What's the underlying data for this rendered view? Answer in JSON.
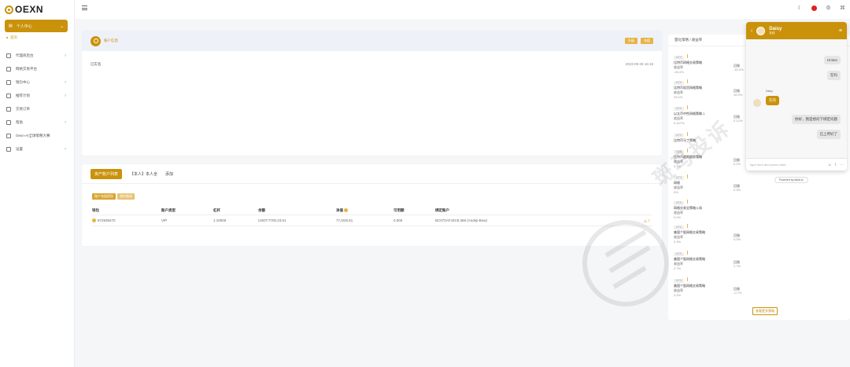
{
  "app": {
    "logo_text": "OEXN"
  },
  "colors": {
    "accent": "#c9920a",
    "accent_light": "#e5b447",
    "alert": "#e02020"
  },
  "sidebar": {
    "active_item": "个人中心",
    "active_subitem": "首页",
    "items": [
      {
        "label": "代理商后台",
        "icon": "grid-icon",
        "has_children": true
      },
      {
        "label": "网格交易平台",
        "icon": "trade-icon",
        "has_children": false
      },
      {
        "label": "钱包中心",
        "icon": "wallet-icon",
        "has_children": true
      },
      {
        "label": "推荐计划",
        "icon": "link-icon",
        "has_children": true
      },
      {
        "label": "交易订单",
        "icon": "order-icon",
        "has_children": false
      },
      {
        "label": "帮助",
        "icon": "help-icon",
        "has_children": true
      },
      {
        "label": "Oexn-AI全球策略大赛",
        "icon": "ai-icon",
        "has_children": false
      },
      {
        "label": "设置",
        "icon": "settings-icon",
        "has_children": true
      }
    ]
  },
  "profile_card": {
    "name": "账户信息",
    "btn1": "升级",
    "btn2": "充值",
    "row_label": "已实名",
    "row_time": "2023-09-28 16:18"
  },
  "accounts_card": {
    "tabs": [
      "资产账户列表",
      "【本人】本人全",
      "添加"
    ],
    "filters": [
      "账户充值提现",
      "我的邀请"
    ],
    "headers": [
      "钱包",
      "账户类型",
      "杠杆",
      "余额",
      "净值",
      "可用额",
      "绑定账户"
    ],
    "row": [
      "872939470",
      "VIP",
      "1:10000",
      "USDT:7700.23.51",
      "77,0/25.51",
      "0.000",
      "BC072AF42C8.368 (Andeji-Bow)"
    ],
    "warn": "⚠ !"
  },
  "strategy_panel": {
    "title": "量化策略 / 收益率",
    "items": [
      {
        "tag": "MT5",
        "title": "比特币网格交易策略",
        "label": "收益率",
        "value": "-15.4%",
        "label2": "回撤",
        "value2": "-15.4%"
      },
      {
        "tag": "MT5",
        "title": "比特币现货网格策略",
        "label": "收益率",
        "value": "33.0%",
        "label2": "回撤",
        "value2": "16.9%"
      },
      {
        "tag": "MT5",
        "title": "以太币中性网格策略 1",
        "label": "收益率",
        "value": "0.447%",
        "label2": "回撤",
        "value2": "0.12%"
      },
      {
        "tag": "MT5",
        "title": "比特币马丁策略",
        "label": "",
        "value": "",
        "label2": "",
        "value2": ""
      },
      {
        "tag": "MT5",
        "title": "比特币趋势跟踪策略",
        "label": "收益率",
        "value": "0.2%",
        "label2": "回撤",
        "value2": "0.2%"
      },
      {
        "tag": "MT5",
        "title": "网格",
        "label": "收益率",
        "value": "0%",
        "label2": "回撤",
        "value2": "0.3%"
      },
      {
        "tag": "MT5",
        "title": "网格交易全策略入场",
        "label": "收益率",
        "value": "0.0%",
        "label2": "",
        "value2": ""
      },
      {
        "tag": "MT5",
        "title": "美国个股网格交易策略",
        "label": "收益率",
        "value": "0.3%",
        "label2": "回撤",
        "value2": "0.0%"
      },
      {
        "tag": "MT5",
        "title": "美国个股网格交易策略",
        "label": "收益率",
        "value": "2.7%",
        "label2": "回撤",
        "value2": "2.7%"
      },
      {
        "tag": "MT5",
        "title": "美国个股网格交易策略",
        "label": "收益率",
        "value": "0.4%",
        "label2": "回撤",
        "value2": "-0.7%"
      }
    ],
    "more_button": "查看更多策略"
  },
  "chat": {
    "agent_name": "Daisy",
    "status": "在线",
    "messages": [
      {
        "from": "me",
        "text": "Hi-ben"
      },
      {
        "from": "me",
        "text": "在吗"
      },
      {
        "from": "bot",
        "sender": "Daisy",
        "text": "在的"
      },
      {
        "from": "me",
        "text": "你好，我是想问下绑定问题"
      },
      {
        "from": "me",
        "text": "已上传好了"
      }
    ],
    "input_placeholder": "Type here and press enter..",
    "powered_by": "Powered by tawk.to"
  },
  "watermark": "斑马投诉"
}
